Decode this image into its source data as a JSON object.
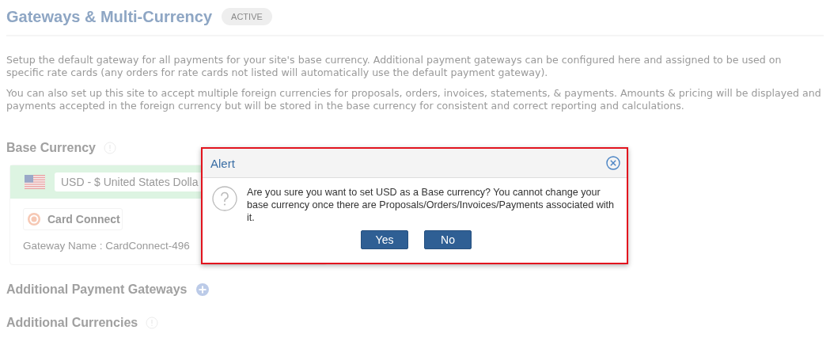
{
  "page": {
    "title": "Gateways & Multi-Currency",
    "status_badge": "ACTIVE",
    "paragraphs": [
      "Setup the default gateway for all payments for your site's base currency. Additional payment gateways can be configured here and assigned to be used on specific rate cards (any orders for rate cards not listed will automatically use the default payment gateway).",
      "You can also set up this site to accept multiple foreign currencies for proposals, orders, invoices, statements, & payments. Amounts & pricing will be displayed and payments accepted in the foreign currency but will be stored in the base currency for consistent and correct reporting and calculations."
    ],
    "base_currency": {
      "heading": "Base Currency",
      "currency_value": "USD - $ United States Dolla",
      "gateway_button": "Card Connect",
      "gateway_name": "Gateway Name : CardConnect-496"
    },
    "additional_gateways": {
      "heading": "Additional Payment Gateways"
    },
    "additional_currencies": {
      "heading": "Additional Currencies"
    }
  },
  "dialog": {
    "title": "Alert",
    "message": "Are you sure you want to set USD as a Base currency? You cannot change your base currency once there are Proposals/Orders/Invoices/Payments associated with it.",
    "buttons": [
      "Yes",
      "No"
    ]
  }
}
